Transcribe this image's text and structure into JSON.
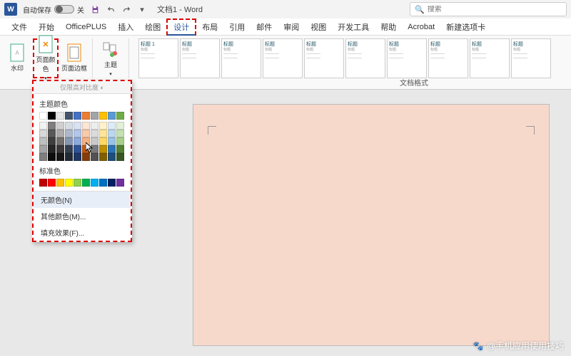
{
  "titlebar": {
    "autosave_label": "自动保存",
    "autosave_state": "关",
    "doc_title": "文档1 - Word"
  },
  "search": {
    "placeholder": "搜索"
  },
  "tabs": [
    "文件",
    "开始",
    "OfficePLUS",
    "插入",
    "绘图",
    "设计",
    "布局",
    "引用",
    "邮件",
    "审阅",
    "视图",
    "开发工具",
    "帮助",
    "Acrobat",
    "新建选项卡"
  ],
  "active_tab_index": 5,
  "ribbon": {
    "watermark": "水印",
    "page_color": "页面颜色",
    "page_border": "页面边框",
    "theme": "主题",
    "theme_previews": [
      "标题 1",
      "标题",
      "标题",
      "标题",
      "标题",
      "标题",
      "标题",
      "标题",
      "标题",
      "标题"
    ],
    "doc_format": "文档格式"
  },
  "popup": {
    "contrast_label": "仅限高对比度",
    "theme_colors_label": "主题颜色",
    "standard_colors_label": "标准色",
    "no_color": "无颜色(N)",
    "more_colors": "其他颜色(M)...",
    "fill_effects": "填充效果(F)...",
    "theme_swatches_row1": [
      "#ffffff",
      "#000000",
      "#e7e6e6",
      "#44546a",
      "#4472c4",
      "#ed7d31",
      "#a5a5a5",
      "#ffc000",
      "#5b9bd5",
      "#70ad47"
    ],
    "theme_swatches_shades": [
      [
        "#f2f2f2",
        "#7f7f7f",
        "#d0cece",
        "#d6dce4",
        "#d9e2f3",
        "#fbe5d5",
        "#ededed",
        "#fff2cc",
        "#deebf6",
        "#e2efd9"
      ],
      [
        "#d8d8d8",
        "#595959",
        "#aeabab",
        "#adb9ca",
        "#b4c6e7",
        "#f7cbac",
        "#dbdbdb",
        "#fee599",
        "#bdd7ee",
        "#c5e0b3"
      ],
      [
        "#bfbfbf",
        "#3f3f3f",
        "#757070",
        "#8496b0",
        "#8eaadb",
        "#f4b183",
        "#c9c9c9",
        "#ffd965",
        "#9cc3e5",
        "#a8d08d"
      ],
      [
        "#a5a5a5",
        "#262626",
        "#3a3838",
        "#323f4f",
        "#2f5496",
        "#c55a11",
        "#7b7b7b",
        "#bf9000",
        "#2e75b5",
        "#538135"
      ],
      [
        "#7f7f7f",
        "#0c0c0c",
        "#171616",
        "#222a35",
        "#1f3864",
        "#833c0b",
        "#525252",
        "#7f6000",
        "#1e4e79",
        "#375623"
      ]
    ],
    "standard_swatches": [
      "#c00000",
      "#ff0000",
      "#ffc000",
      "#ffff00",
      "#92d050",
      "#00b050",
      "#00b0f0",
      "#0070c0",
      "#002060",
      "#7030a0"
    ]
  },
  "page_bg": "#f7d9cc",
  "watermark_text": "@手机应用使用技巧"
}
